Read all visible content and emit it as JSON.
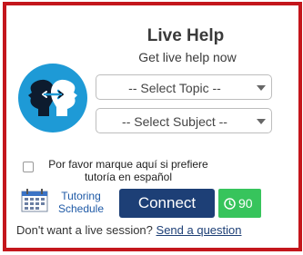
{
  "widget": {
    "title": "Live Help",
    "subtitle": "Get live help now",
    "logo_icon": "people-exchange-icon",
    "topic_select": {
      "value": "-- Select Topic --"
    },
    "subject_select": {
      "value": "-- Select Subject --"
    },
    "spanish_checkbox": {
      "label": "Por favor marque aquí si prefiere tutoría en español",
      "checked": false
    },
    "tutoring_schedule": {
      "label": "Tutoring Schedule",
      "icon": "calendar-icon"
    },
    "connect_button": {
      "label": "Connect"
    },
    "timer": {
      "value": "90",
      "icon": "clock-icon"
    },
    "footer": {
      "text": "Don't want a live session?",
      "link": "Send a question"
    }
  },
  "colors": {
    "border": "#c4161c",
    "logo_bg": "#1e9ad6",
    "connect_bg": "#1d3f76",
    "timer_bg": "#37c45c",
    "link": "#1f5aa6"
  }
}
